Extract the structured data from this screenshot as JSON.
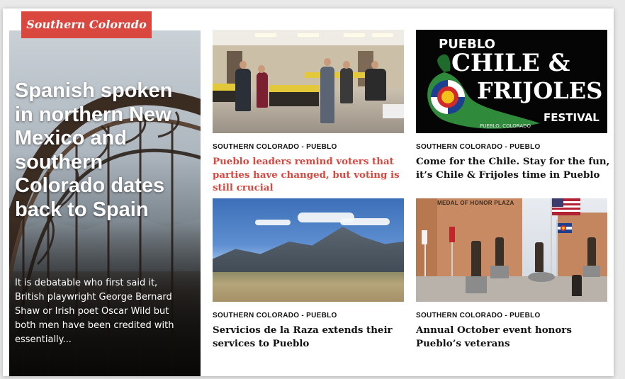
{
  "section": {
    "region_tag": "Southern Colorado"
  },
  "feature": {
    "title": "Spanish spoken in northern New Mexico and southern Colorado dates back to Spain",
    "excerpt": "It is debatable who first said it, British playwright George Bernard Shaw or Irish poet Oscar Wild but both men have been credited with essentially..."
  },
  "stories": [
    {
      "kicker": "SOUTHERN COLORADO - PUEBLO",
      "headline": "Pueblo leaders remind voters that parties have changed, but voting is still crucial",
      "image": "voting-room-photo",
      "accent": "#d9473f"
    },
    {
      "kicker": "SOUTHERN COLORADO - PUEBLO",
      "headline": "Come for the Chile. Stay for the fun, it’s Chile & Frijoles time in Pueblo",
      "image": "chile-frijoles-festival-logo"
    },
    {
      "kicker": "SOUTHERN COLORADO - PUEBLO",
      "headline": "Servicios de la Raza extends their services to Pueblo",
      "image": "mountain-landscape-photo"
    },
    {
      "kicker": "SOUTHERN COLORADO - PUEBLO",
      "headline": "Annual October event honors Pueblo’s veterans",
      "image": "medal-of-honor-plaza-photo"
    }
  ],
  "chile_logo": {
    "top": "PUEBLO",
    "line1": "CHILE &",
    "line2": "FRIJOLES",
    "line3": "FESTIVAL",
    "small": "PUEBLO, COLORADO"
  },
  "plaza_sign": "MEDAL OF HONOR PLAZA",
  "colors": {
    "accent": "#d9473f",
    "text": "#111111",
    "background": "#ffffff"
  }
}
